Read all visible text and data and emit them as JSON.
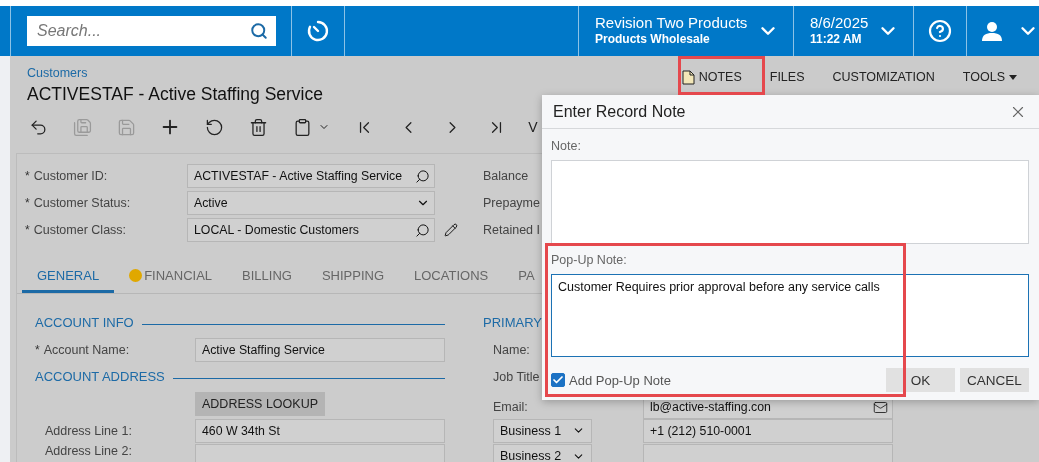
{
  "header": {
    "search": {
      "placeholder": "Search..."
    },
    "company": {
      "name": "Revision Two Products",
      "branch": "Products Wholesale"
    },
    "datetime": {
      "date": "8/6/2025",
      "time": "11:22 AM"
    }
  },
  "breadcrumb": "Customers",
  "title": "ACTIVESTAF - Active Staffing Service",
  "top_actions": [
    {
      "label": "NOTES",
      "kind": "note"
    },
    {
      "label": "FILES",
      "kind": "plain"
    },
    {
      "label": "CUSTOMIZATION",
      "kind": "plain"
    },
    {
      "label": "TOOLS",
      "kind": "menu"
    }
  ],
  "toolbar": [
    {
      "kind": "back",
      "disabled": false
    },
    {
      "kind": "save_close",
      "disabled": true
    },
    {
      "kind": "save",
      "disabled": true
    },
    {
      "kind": "add",
      "disabled": false
    },
    {
      "kind": "undo",
      "disabled": false
    },
    {
      "kind": "delete",
      "disabled": false
    },
    {
      "kind": "copy_paste",
      "disabled": false
    },
    {
      "kind": "first",
      "disabled": false
    },
    {
      "kind": "prev",
      "disabled": false
    },
    {
      "kind": "next",
      "disabled": false
    },
    {
      "kind": "last",
      "disabled": false
    },
    {
      "kind": "text",
      "label": "V",
      "disabled": false
    }
  ],
  "summary": {
    "fields": [
      {
        "label": "Customer ID:",
        "required_mark": "*",
        "value": "ACTIVESTAF - Active Staffing Service",
        "kind": "lookup",
        "editable": false
      },
      {
        "label": "Customer Status:",
        "required_mark": "*",
        "value": "Active",
        "kind": "select",
        "editable": false
      },
      {
        "label": "Customer Class:",
        "required_mark": "*",
        "value": "LOCAL - Domestic Customers",
        "kind": "lookup",
        "editable": true
      }
    ],
    "right_labels": [
      "Balance",
      "Prepayme",
      "Retained I"
    ]
  },
  "tabs": [
    {
      "label": "GENERAL",
      "selected": true,
      "warning": false
    },
    {
      "label": "FINANCIAL",
      "selected": false,
      "warning": true
    },
    {
      "label": "BILLING",
      "selected": false,
      "warning": false
    },
    {
      "label": "SHIPPING",
      "selected": false,
      "warning": false
    },
    {
      "label": "LOCATIONS",
      "selected": false,
      "warning": false
    },
    {
      "label": "PA",
      "selected": false,
      "warning": false
    }
  ],
  "account_info": {
    "title": "ACCOUNT INFO",
    "fields": [
      {
        "label": "Account Name:",
        "required_mark": "*",
        "value": "Active Staffing Service"
      }
    ]
  },
  "account_address": {
    "title": "ACCOUNT ADDRESS",
    "lookup_button": "ADDRESS LOOKUP",
    "fields": [
      {
        "label": "Address Line 1:",
        "value": "460 W 34th St"
      },
      {
        "label": "Address Line 2:"
      }
    ]
  },
  "primary_contact": {
    "title": "PRIMARY",
    "labels": [
      "Name:",
      "Job Title"
    ],
    "email": {
      "label": "Email:",
      "value": "lb@active-staffing.con"
    },
    "phones": [
      {
        "type": "Business 1",
        "value": "+1 (212) 510-0001"
      },
      {
        "type": "Business 2"
      }
    ]
  },
  "dialog": {
    "title": "Enter Record Note",
    "note": {
      "label": "Note:"
    },
    "popup_note": {
      "label": "Pop-Up Note:",
      "value": "Customer Requires prior approval before any service calls"
    },
    "add_popup": {
      "label": "Add Pop-Up Note",
      "checked": true
    },
    "buttons": [
      "OK",
      "CANCEL"
    ]
  }
}
